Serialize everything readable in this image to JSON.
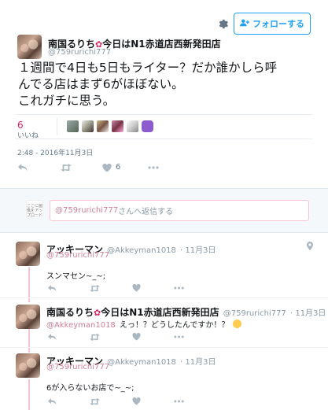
{
  "header": {
    "follow_label": "フォローする",
    "author_name": "南国るりち",
    "author_name_suffix": "今日はN1赤道店西新発田店",
    "author_handle": "@759rurichi777"
  },
  "tweet": {
    "text_line1": "１週間で4日も5日もライター？だか誰かしら呼",
    "text_line2": "んでる店はまず6がほぼない。",
    "text_line3": "これガチに思う。",
    "likes_count": "6",
    "likes_label": "いいね",
    "timestamp": "2:48 - 2016年11月3日",
    "action_like_count": "6"
  },
  "reply_box": {
    "mention": "@759rurichi777",
    "placeholder_suffix": "さんへ返信する",
    "mini_avatar_text": "ここに画像をアップロード"
  },
  "replies": [
    {
      "name": "アッキーマン",
      "handle": "@Akkeyman1018",
      "date": "· 11月3日",
      "reply_to": "@759rurichi777",
      "text": "スンマセン~_~;"
    },
    {
      "name": "南国るりち",
      "name_suffix": "今日はN1赤道店西新発田店",
      "handle": "@759rurichi777",
      "date": "· 11月3日",
      "reply_to": "@Akkeyman1018",
      "text": "えっ！？どうしたんですか！？"
    },
    {
      "name": "アッキーマン",
      "handle": "@Akkeyman1018",
      "date": "· 11月3日",
      "reply_to": "@759rurichi777",
      "text": "6が入らないお店で~_~;"
    }
  ],
  "colors": {
    "accent": "#1da1f2",
    "like": "#e0245e",
    "mention": "#d17e95",
    "muted": "#8899a6"
  }
}
